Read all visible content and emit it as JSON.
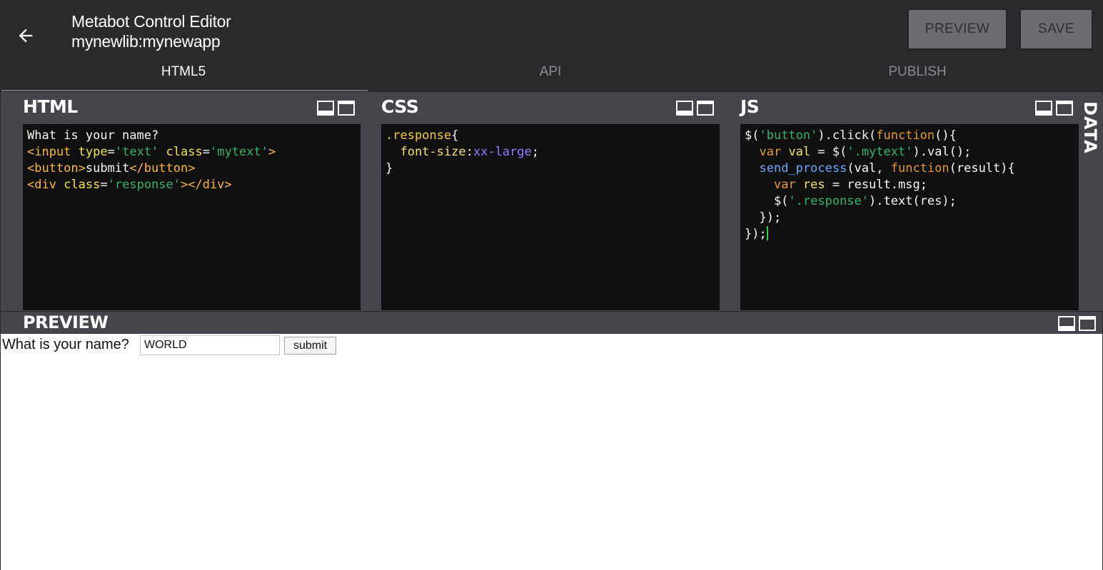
{
  "header": {
    "title": "Metabot Control Editor",
    "subtitle": "mynewlib:mynewapp",
    "preview_label": "PREVIEW",
    "save_label": "SAVE",
    "back_icon": "arrow-left-icon"
  },
  "tabs": [
    {
      "label": "HTML5",
      "active": true
    },
    {
      "label": "API",
      "active": false
    },
    {
      "label": "PUBLISH",
      "active": false
    }
  ],
  "panels": {
    "html": {
      "label": "HTML"
    },
    "css": {
      "label": "CSS"
    },
    "js": {
      "label": "JS"
    },
    "data": {
      "label": "DATA"
    },
    "preview": {
      "label": "PREVIEW"
    }
  },
  "code": {
    "html": [
      [
        {
          "t": "What is your name?",
          "c": "def"
        }
      ],
      [
        {
          "t": "<input",
          "c": "tag"
        },
        {
          "t": " ",
          "c": "def"
        },
        {
          "t": "type",
          "c": "attr"
        },
        {
          "t": "=",
          "c": "def"
        },
        {
          "t": "'text'",
          "c": "str"
        },
        {
          "t": " ",
          "c": "def"
        },
        {
          "t": "class",
          "c": "attr"
        },
        {
          "t": "=",
          "c": "def"
        },
        {
          "t": "'mytext'",
          "c": "str"
        },
        {
          "t": ">",
          "c": "tag"
        }
      ],
      [
        {
          "t": "<button>",
          "c": "tag"
        },
        {
          "t": "submit",
          "c": "def"
        },
        {
          "t": "</button>",
          "c": "tag"
        }
      ],
      [
        {
          "t": "<div",
          "c": "tag"
        },
        {
          "t": " ",
          "c": "def"
        },
        {
          "t": "class",
          "c": "attr"
        },
        {
          "t": "=",
          "c": "def"
        },
        {
          "t": "'response'",
          "c": "str"
        },
        {
          "t": "></div>",
          "c": "tag"
        }
      ]
    ],
    "css": [
      [
        {
          "t": ".response",
          "c": "sel"
        },
        {
          "t": "{",
          "c": "def"
        }
      ],
      [
        {
          "t": "  font-size",
          "c": "prop"
        },
        {
          "t": ":",
          "c": "def"
        },
        {
          "t": "xx-large",
          "c": "css"
        },
        {
          "t": ";",
          "c": "def"
        }
      ],
      [
        {
          "t": "}",
          "c": "def"
        }
      ]
    ],
    "js": [
      [
        {
          "t": "$(",
          "c": "def"
        },
        {
          "t": "'button'",
          "c": "str"
        },
        {
          "t": ").click(",
          "c": "def"
        },
        {
          "t": "function",
          "c": "kw"
        },
        {
          "t": "(){",
          "c": "def"
        }
      ],
      [
        {
          "t": "  ",
          "c": "def"
        },
        {
          "t": "var",
          "c": "kw"
        },
        {
          "t": " ",
          "c": "def"
        },
        {
          "t": "val",
          "c": "prop"
        },
        {
          "t": " = $(",
          "c": "def"
        },
        {
          "t": "'.mytext'",
          "c": "str"
        },
        {
          "t": ").val();",
          "c": "def"
        }
      ],
      [
        {
          "t": "  ",
          "c": "def"
        },
        {
          "t": "send_process",
          "c": "var"
        },
        {
          "t": "(val, ",
          "c": "def"
        },
        {
          "t": "function",
          "c": "kw"
        },
        {
          "t": "(result){",
          "c": "def"
        }
      ],
      [
        {
          "t": "    ",
          "c": "def"
        },
        {
          "t": "var",
          "c": "kw"
        },
        {
          "t": " ",
          "c": "def"
        },
        {
          "t": "res",
          "c": "prop"
        },
        {
          "t": " = result.msg;",
          "c": "def"
        }
      ],
      [
        {
          "t": "    $(",
          "c": "def"
        },
        {
          "t": "'.response'",
          "c": "str"
        },
        {
          "t": ").text(res);",
          "c": "def"
        }
      ],
      [
        {
          "t": "  });",
          "c": "def"
        }
      ],
      [
        {
          "t": "});",
          "c": "def"
        }
      ]
    ]
  },
  "preview": {
    "question": "What is your name?",
    "input_value": "WORLD",
    "submit_label": "submit"
  },
  "colors": {
    "appbar": "#2b2b2e",
    "panel": "#45464c",
    "editor_bg": "#101010",
    "cursor": "#26d04d"
  }
}
